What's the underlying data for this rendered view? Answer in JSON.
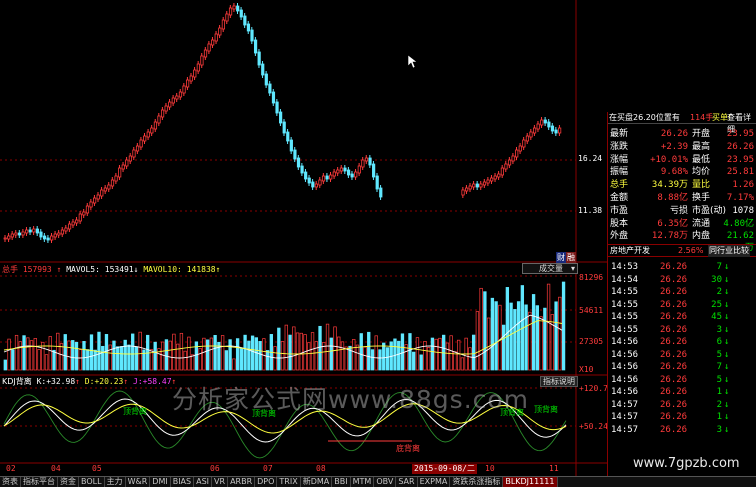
{
  "colors": {
    "up": "#ff3b3b",
    "down": "#60e8ff",
    "grid": "#8a0000",
    "ma5": "#ffffff",
    "ma10": "#ffff40",
    "k": "#ffffff",
    "d": "#ffff40",
    "j": "#cc66ff"
  },
  "price_axis": [
    "16.24",
    "11.38"
  ],
  "volume_header": {
    "vol_label": "总手",
    "vol_value": "157993",
    "ma5_label": "MAVOL5:",
    "ma5_value": "153491",
    "ma10_label": "MAVOL10:",
    "ma10_value": "141838"
  },
  "volume_axis": [
    "81296",
    "54611",
    "27305",
    "X10"
  ],
  "volume_selector": "成交量",
  "badge_finance": "财",
  "badge_rong": "融",
  "kdj_header": {
    "name": "KDJ背离",
    "k_label": "K:",
    "k_value": "+32.98",
    "d_label": "D:",
    "d_value": "+20.23",
    "j_label": "J:",
    "j_value": "+58.47"
  },
  "kdj_button": "指标说明",
  "kdj_axis": [
    "+120.7",
    "+50.24"
  ],
  "kdj_labels": [
    "顶背离",
    "顶背离",
    "顶背离",
    "顶背离",
    "底背离"
  ],
  "date_axis": [
    "02",
    "04",
    "05",
    "06",
    "07",
    "08",
    "10",
    "11"
  ],
  "date_cursor": "2015-09-08/二",
  "info": {
    "header_left": "在买盘26.20位置有",
    "header_qty": "114手",
    "header_buy": "买单!",
    "header_link": "查看详细",
    "rows": [
      {
        "k1": "最新",
        "v1": "26.26",
        "k2": "开盘",
        "v2": "23.95"
      },
      {
        "k1": "涨跌",
        "v1": "+2.39",
        "k2": "最高",
        "v2": "26.26"
      },
      {
        "k1": "涨幅",
        "v1": "+10.01%",
        "k2": "最低",
        "v2": "23.95"
      },
      {
        "k1": "振幅",
        "v1": "9.68%",
        "k2": "均价",
        "v2": "25.81"
      },
      {
        "k1": "总手",
        "v1": "34.39万",
        "k2": "量比",
        "v2": "1.26"
      },
      {
        "k1": "金额",
        "v1": "8.88亿",
        "k2": "换手",
        "v2": "7.17%"
      },
      {
        "k1": "市盈",
        "v1": "亏损",
        "k2": "市盈(动)",
        "v2": "1078"
      },
      {
        "k1": "股本",
        "v1": "6.35亿",
        "k2": "流通",
        "v2": "4.80亿"
      },
      {
        "k1": "外盘",
        "v1": "12.78万",
        "k2": "内盘",
        "v2": "21.62万"
      }
    ],
    "sector": "房地产开发",
    "sector_pct": "2.56%",
    "sector_link": "同行业比较",
    "ticks": [
      {
        "time": "14:53",
        "price": "26.26",
        "qty": "7",
        "dir": "down"
      },
      {
        "time": "14:54",
        "price": "26.26",
        "qty": "30",
        "dir": "down"
      },
      {
        "time": "14:55",
        "price": "26.26",
        "qty": "2",
        "dir": "down"
      },
      {
        "time": "14:55",
        "price": "26.26",
        "qty": "25",
        "dir": "down"
      },
      {
        "time": "14:55",
        "price": "26.26",
        "qty": "45",
        "dir": "down"
      },
      {
        "time": "14:55",
        "price": "26.26",
        "qty": "3",
        "dir": "down"
      },
      {
        "time": "14:56",
        "price": "26.26",
        "qty": "6",
        "dir": "down"
      },
      {
        "time": "14:56",
        "price": "26.26",
        "qty": "5",
        "dir": "down"
      },
      {
        "time": "14:56",
        "price": "26.26",
        "qty": "7",
        "dir": "down"
      },
      {
        "time": "14:56",
        "price": "26.26",
        "qty": "5",
        "dir": "down"
      },
      {
        "time": "14:56",
        "price": "26.26",
        "qty": "1",
        "dir": "down"
      },
      {
        "time": "14:57",
        "price": "26.26",
        "qty": "2",
        "dir": "down"
      },
      {
        "time": "14:57",
        "price": "26.26",
        "qty": "1",
        "dir": "down"
      },
      {
        "time": "14:57",
        "price": "26.26",
        "qty": "3",
        "dir": "down"
      }
    ]
  },
  "tabs": [
    "资表",
    "指标平台",
    "资金",
    "BOLL",
    "主力",
    "W&R",
    "DMI",
    "BIAS",
    "ASI",
    "VR",
    "ARBR",
    "DPO",
    "TRIX",
    "新DMA",
    "BBI",
    "MTM",
    "OBV",
    "SAR",
    "EXPMA",
    "资跌杀涨指标",
    "BLKDJ11111"
  ],
  "active_tab": 20,
  "watermark": "分析家公式网www.88gs.com",
  "watermark2": "www.7gpzb.com"
}
